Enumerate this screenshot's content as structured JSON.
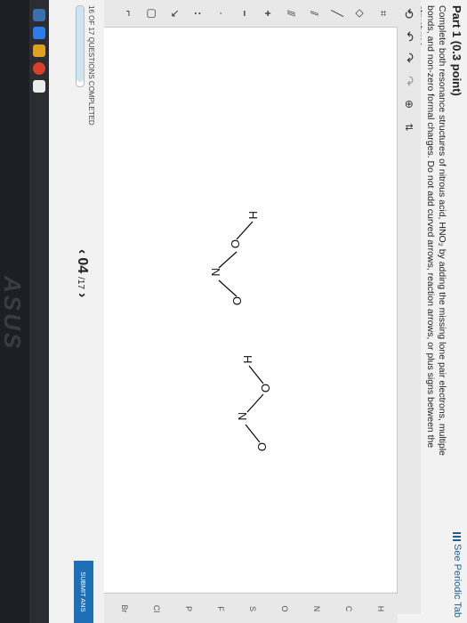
{
  "header": {
    "part_title": "Part 1  (0.3 point)",
    "periodic_link": "See Periodic Tab"
  },
  "instructions": "Complete both resonance structures of nitrous acid, HNO₂ by adding the missing lone pair electrons, multiple bonds, and non-zero formal charges. Do not add curved arrows, reaction arrows, or plus signs between the structures.",
  "toolbar": {
    "top_icons": [
      "erase-icon",
      "undo-icon",
      "redo-icon",
      "zoom-icon",
      "template-icon"
    ],
    "left_tools": [
      "select-icon",
      "single-bond-icon",
      "double-bond-icon",
      "triple-bond-icon",
      "plus-charge",
      "minus-charge",
      "lone-pair-icon",
      "radical-icon",
      "ring-icon"
    ],
    "plus_label": "+",
    "minus_label": "−",
    "lone_pair_label": ":",
    "right_elements": [
      "H",
      "C",
      "N",
      "O",
      "S",
      "F",
      "P",
      "Cl",
      "Br"
    ]
  },
  "structures": [
    {
      "atoms": [
        "H",
        "O",
        "N",
        "O"
      ]
    },
    {
      "atoms": [
        "H",
        "O",
        "N",
        "O"
      ]
    }
  ],
  "footer": {
    "progress_label": "16 OF 17 QUESTIONS COMPLETED",
    "progress_fraction": 0.94,
    "pager_current": "04",
    "pager_total": "/17",
    "prev_label": "‹",
    "next_label": "›",
    "submit_label": "SUBMIT ANS"
  },
  "device": {
    "brand": "ASUS"
  }
}
